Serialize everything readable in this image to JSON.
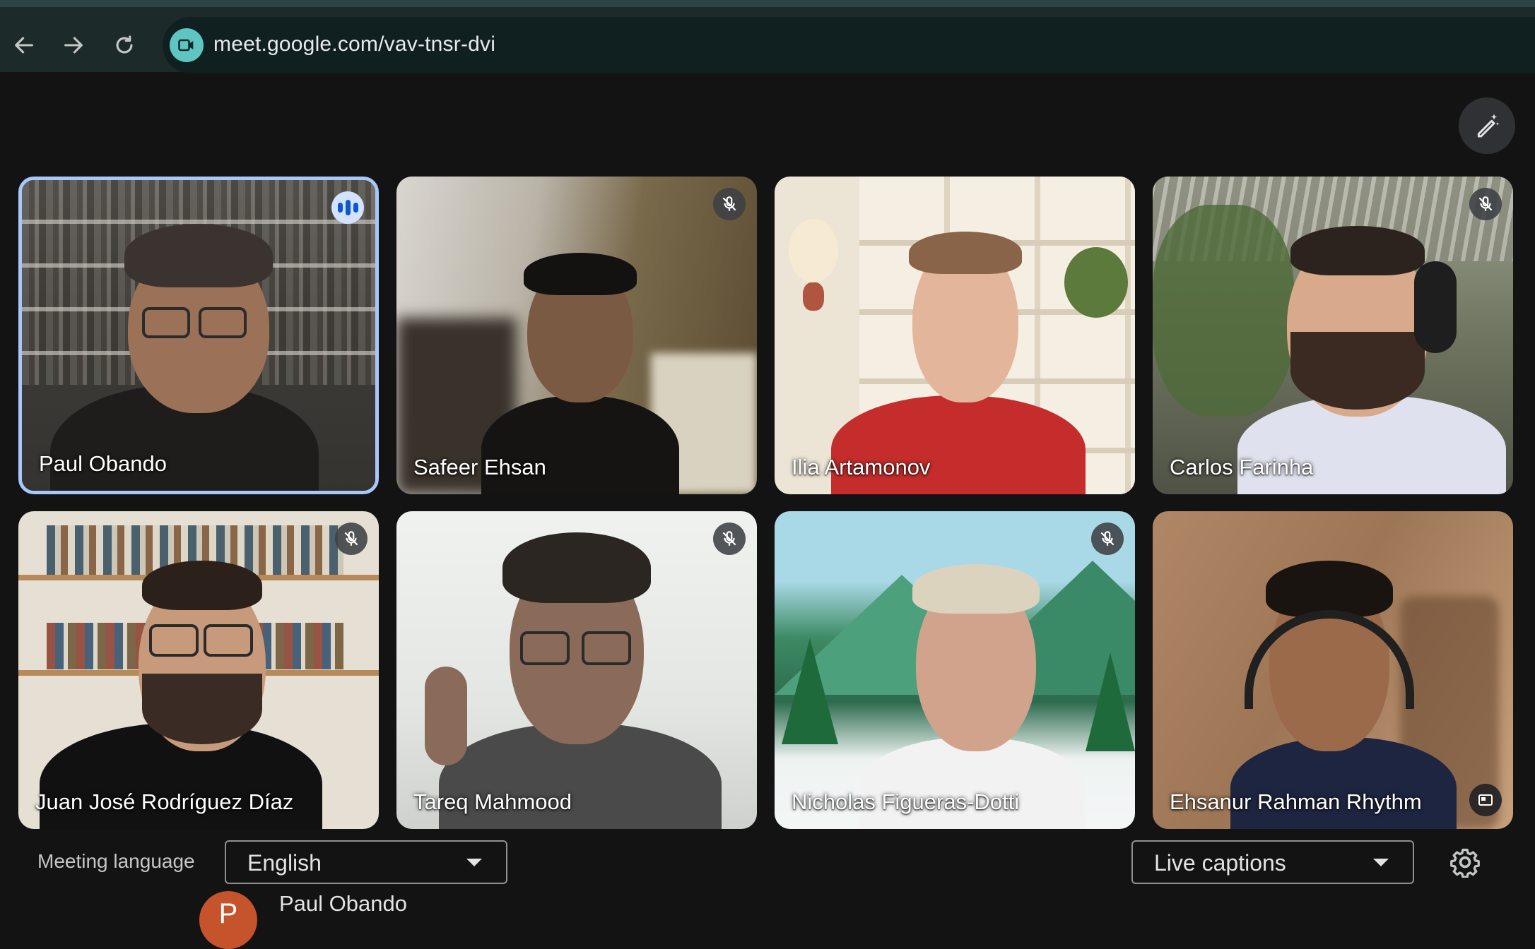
{
  "browser": {
    "url": "meet.google.com/vav-tnsr-dvi",
    "back_icon": "arrow-left-icon",
    "forward_icon": "arrow-right-icon",
    "reload_icon": "reload-icon",
    "site_icon": "meet-camera-icon"
  },
  "participants": [
    {
      "name": "Paul Obando",
      "status": "speaking",
      "active": true
    },
    {
      "name": "Safeer Ehsan",
      "status": "muted"
    },
    {
      "name": "Ilia Artamonov",
      "status": "none"
    },
    {
      "name": "Carlos Farinha",
      "status": "muted"
    },
    {
      "name": "Juan José Rodríguez Díaz",
      "status": "muted"
    },
    {
      "name": "Tareq Mahmood",
      "status": "muted"
    },
    {
      "name": "Nicholas Figueras-Dotti",
      "status": "muted"
    },
    {
      "name": "Ehsanur Rahman Rhythm",
      "status": "self-view"
    }
  ],
  "captions_bar": {
    "language_label": "Meeting language",
    "language_value": "English",
    "captions_value": "Live captions",
    "settings_icon": "gear-icon"
  },
  "caption": {
    "avatar_letter": "P",
    "speaker": "Paul Obando"
  },
  "colors": {
    "active_border": "#a8c7fa",
    "speaking_badge": "#d3e3fd",
    "avatar": "#c5532b"
  }
}
